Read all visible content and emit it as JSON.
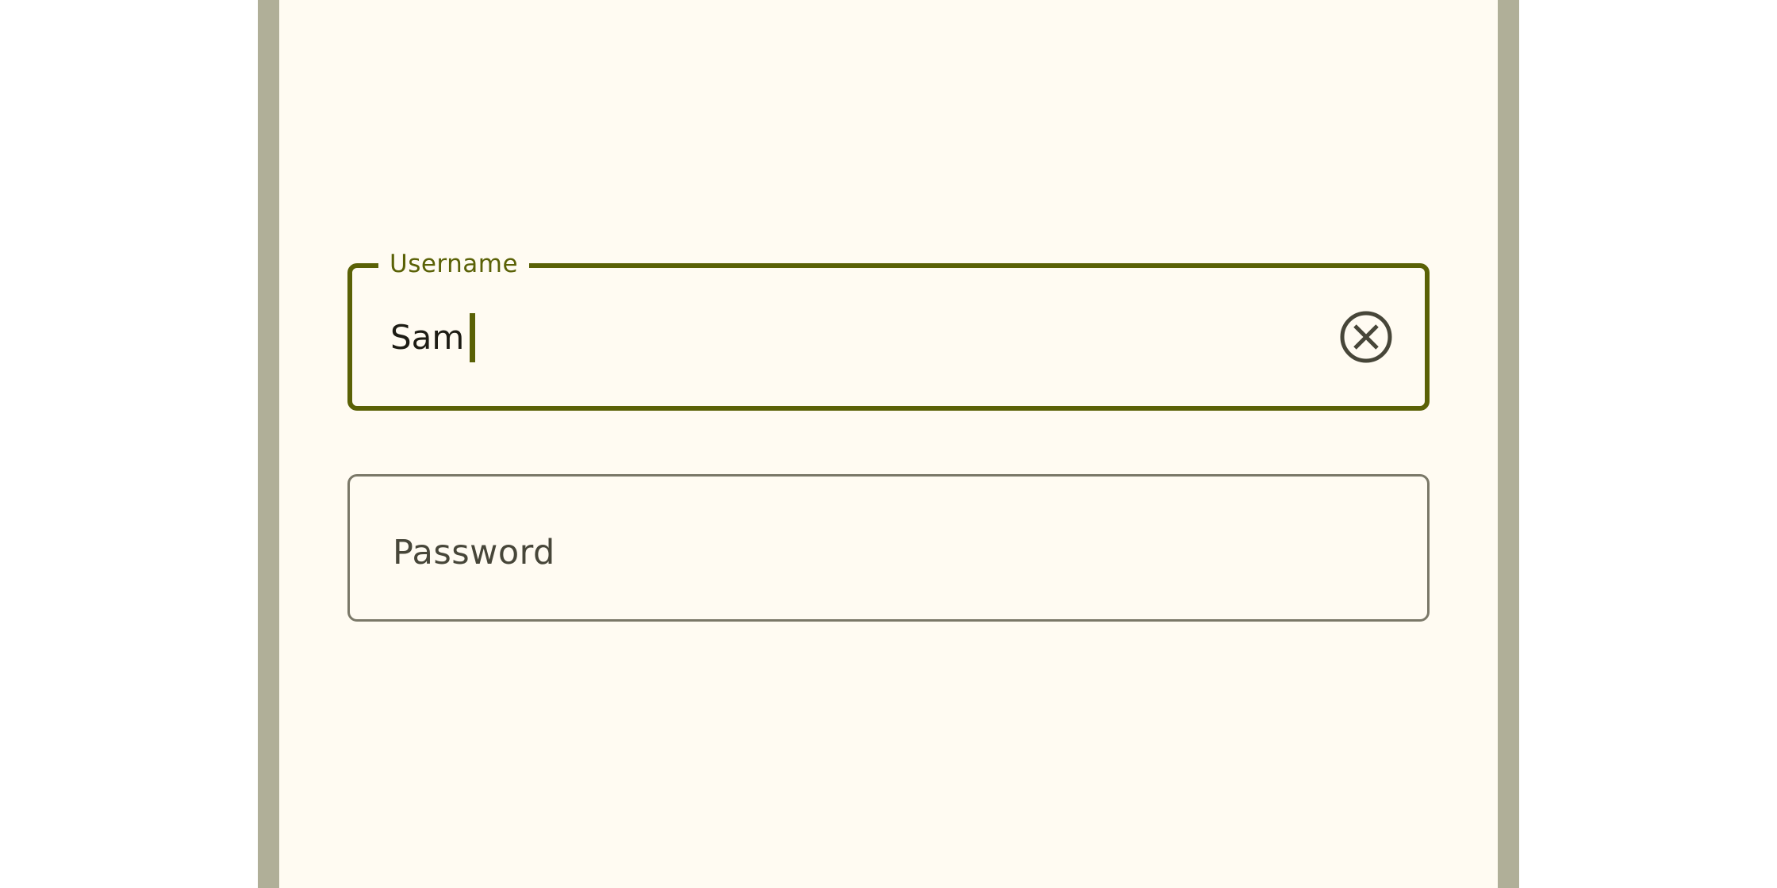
{
  "form": {
    "username": {
      "label": "Username",
      "value": "Sam",
      "state": "focused",
      "trailing_icon": "clear-circle-icon"
    },
    "password": {
      "label": "Password",
      "value": "",
      "state": "unfocused"
    }
  },
  "colors": {
    "page_background": "#ffffff",
    "device_frame": "#b0af98",
    "surface": "#fffbf2",
    "primary": "#5a6106",
    "outline": "#7a7868",
    "on_surface": "#1d1c14",
    "on_surface_variant": "#474639"
  }
}
